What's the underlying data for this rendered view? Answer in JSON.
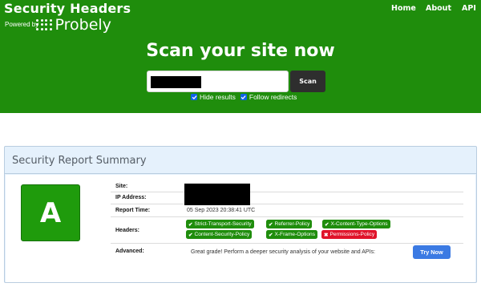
{
  "header": {
    "brand_title": "Security Headers",
    "powered_by": "Powered by",
    "sponsor": "Probely",
    "nav": {
      "home": "Home",
      "about": "About",
      "api": "API"
    },
    "headline": "Scan your site now",
    "scan_label": "Scan",
    "options": [
      {
        "label": "Hide results",
        "checked": true
      },
      {
        "label": "Follow redirects",
        "checked": true
      }
    ]
  },
  "report": {
    "title": "Security Report Summary",
    "grade": "A",
    "grade_color": "#1f9b0c",
    "rows": {
      "site_label": "Site:",
      "ip_label": "IP Address:",
      "time_label": "Report Time:",
      "time_value": "05 Sep 2023 20:38:41 UTC",
      "headers_label": "Headers:",
      "advanced_label": "Advanced:",
      "advanced_text": "Great grade! Perform a deeper security analysis of your website and APIs:",
      "try_label": "Try Now"
    },
    "headers": [
      {
        "name": "Strict-Transport-Security",
        "present": true
      },
      {
        "name": "Referrer-Policy",
        "present": true
      },
      {
        "name": "X-Content-Type-Options",
        "present": true
      },
      {
        "name": "Content-Security-Policy",
        "present": true
      },
      {
        "name": "X-Frame-Options",
        "present": true
      },
      {
        "name": "Permissions-Policy",
        "present": false
      }
    ]
  },
  "colors": {
    "header_green": "#1f8d0c",
    "badge_green": "#1f8d0c",
    "badge_red": "#e0132a",
    "try_blue": "#3b7ae3"
  }
}
